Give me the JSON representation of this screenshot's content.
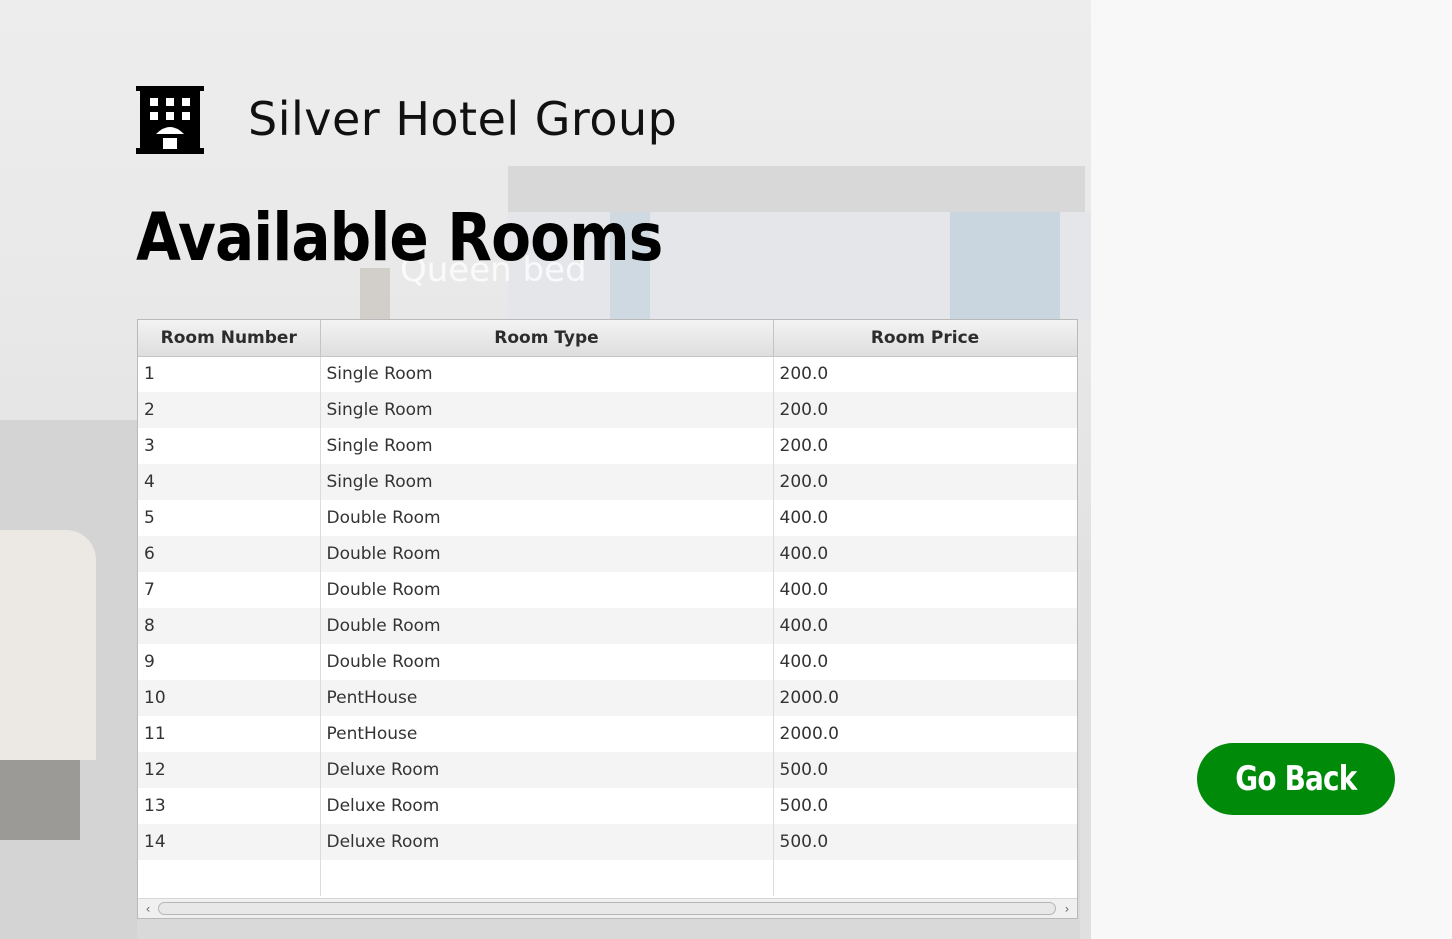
{
  "brand": {
    "title": "Silver Hotel Group",
    "icon": "hotel-building-icon"
  },
  "page": {
    "title": "Available Rooms",
    "background_text": "Queen bed"
  },
  "table": {
    "columns": [
      "Room Number",
      "Room Type",
      "Room Price"
    ],
    "rows": [
      [
        "1",
        "Single Room",
        "200.0"
      ],
      [
        "2",
        "Single Room",
        "200.0"
      ],
      [
        "3",
        "Single Room",
        "200.0"
      ],
      [
        "4",
        "Single Room",
        "200.0"
      ],
      [
        "5",
        "Double Room",
        "400.0"
      ],
      [
        "6",
        "Double Room",
        "400.0"
      ],
      [
        "7",
        "Double Room",
        "400.0"
      ],
      [
        "8",
        "Double Room",
        "400.0"
      ],
      [
        "9",
        "Double Room",
        "400.0"
      ],
      [
        "10",
        "PentHouse",
        "2000.0"
      ],
      [
        "11",
        "PentHouse",
        "2000.0"
      ],
      [
        "12",
        "Deluxe Room",
        "500.0"
      ],
      [
        "13",
        "Deluxe Room",
        "500.0"
      ],
      [
        "14",
        "Deluxe Room",
        "500.0"
      ]
    ]
  },
  "scrollbar": {
    "left_arrow": "‹",
    "right_arrow": "›"
  },
  "actions": {
    "go_back_label": "Go Back"
  },
  "colors": {
    "go_back_button": "#008a0a",
    "right_panel": "#f8f8f8"
  }
}
